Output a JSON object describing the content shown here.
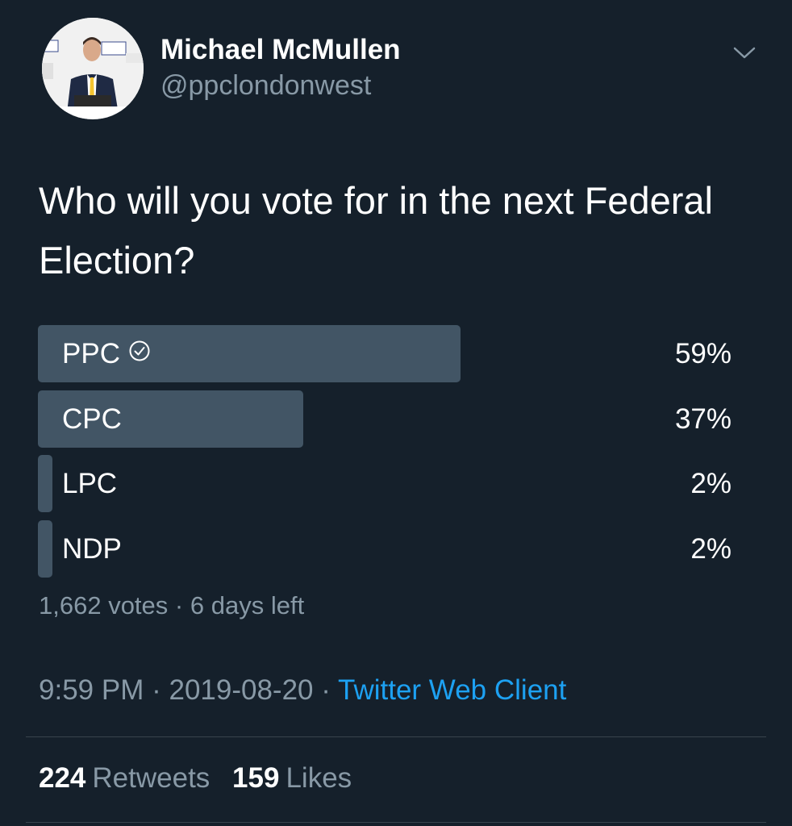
{
  "author": {
    "display_name": "Michael McMullen",
    "handle": "@ppclondonwest",
    "avatar_icon": "profile-photo"
  },
  "menu": {
    "icon": "chevron-down-icon"
  },
  "tweet": {
    "text": "Who will you vote for in the next Federal Election?"
  },
  "poll": {
    "options": [
      {
        "label": "PPC",
        "percent_text": "59%",
        "percent": 59,
        "selected": true
      },
      {
        "label": "CPC",
        "percent_text": "37%",
        "percent": 37,
        "selected": false
      },
      {
        "label": "LPC",
        "percent_text": "2%",
        "percent": 2,
        "selected": false
      },
      {
        "label": "NDP",
        "percent_text": "2%",
        "percent": 2,
        "selected": false
      }
    ],
    "votes": "1,662 votes",
    "separator": "·",
    "time_left": "6 days left"
  },
  "meta": {
    "time": "9:59 PM",
    "separator": "·",
    "date": "2019-08-20",
    "source": "Twitter Web Client"
  },
  "stats": {
    "retweets_count": "224",
    "retweets_label": "Retweets",
    "likes_count": "159",
    "likes_label": "Likes"
  },
  "colors": {
    "background": "#15202b",
    "bar": "#425565",
    "muted_text": "#8899a6",
    "link": "#1da1f2",
    "divider": "#38444d"
  }
}
